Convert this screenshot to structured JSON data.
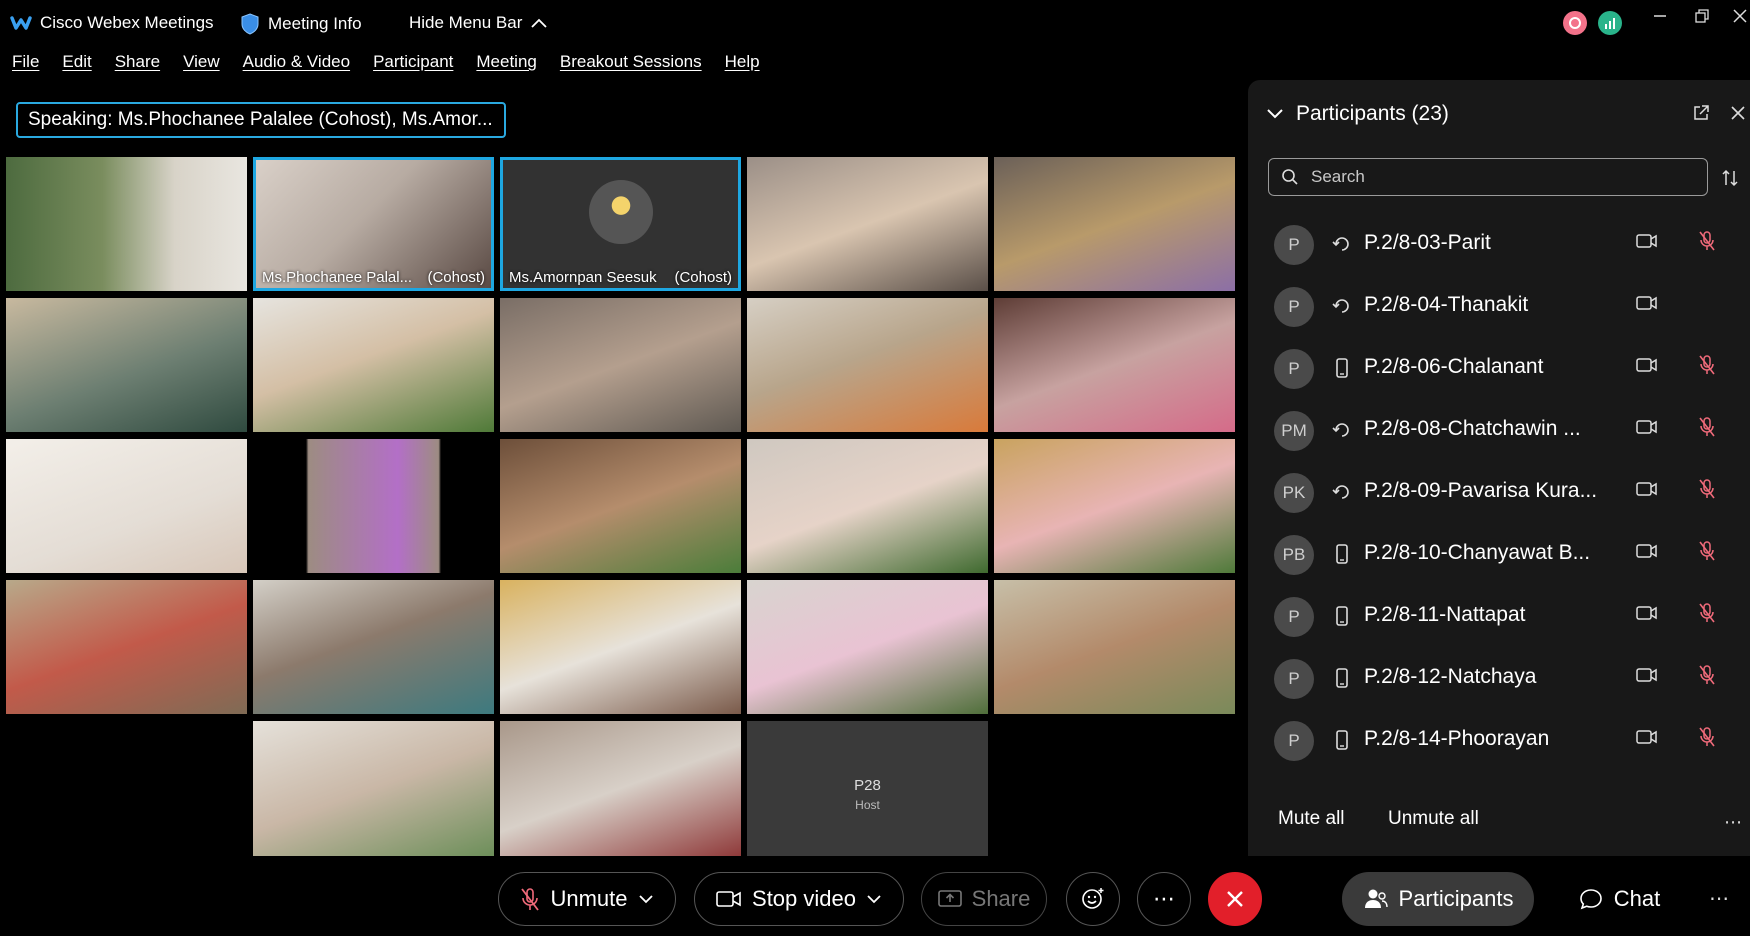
{
  "app": {
    "title": "Cisco Webex Meetings",
    "meeting_info": "Meeting Info",
    "hide_menu": "Hide Menu Bar"
  },
  "menu": [
    "File",
    "Edit",
    "Share",
    "View",
    "Audio & Video",
    "Participant",
    "Meeting",
    "Breakout Sessions",
    "Help"
  ],
  "speaking": {
    "label": "Speaking:",
    "names": "Ms.Phochanee Palalee (Cohost), Ms.Amor..."
  },
  "tiles": {
    "phochanee": {
      "name": "Ms.Phochanee Palal...",
      "role": "(Cohost)"
    },
    "amornpan": {
      "name": "Ms.Amornpan Seesuk",
      "role": "(Cohost)"
    },
    "p28": {
      "name": "P28",
      "role": "Host"
    }
  },
  "panel": {
    "title": "Participants (23)",
    "search_placeholder": "Search",
    "participants": [
      {
        "initials": "P",
        "device": "sync",
        "name": "P.2/8-03-Parit",
        "muted": true
      },
      {
        "initials": "P",
        "device": "sync",
        "name": "P.2/8-04-Thanakit",
        "muted": false
      },
      {
        "initials": "P",
        "device": "phone",
        "name": "P.2/8-06-Chalanant",
        "muted": true
      },
      {
        "initials": "PM",
        "device": "sync",
        "name": "P.2/8-08-Chatchawin ...",
        "muted": true
      },
      {
        "initials": "PK",
        "device": "sync",
        "name": "P.2/8-09-Pavarisa Kura...",
        "muted": true
      },
      {
        "initials": "PB",
        "device": "phone",
        "name": "P.2/8-10-Chanyawat B...",
        "muted": true
      },
      {
        "initials": "P",
        "device": "phone",
        "name": "P.2/8-11-Nattapat",
        "muted": true
      },
      {
        "initials": "P",
        "device": "phone",
        "name": "P.2/8-12-Natchaya",
        "muted": true
      },
      {
        "initials": "P",
        "device": "phone",
        "name": "P.2/8-14-Phoorayan",
        "muted": true
      }
    ],
    "mute_all": "Mute all",
    "unmute_all": "Unmute all"
  },
  "bottom": {
    "unmute": "Unmute",
    "stop_video": "Stop video",
    "share": "Share",
    "participants": "Participants",
    "chat": "Chat"
  },
  "colors": {
    "accent": "#1ea7e1",
    "end_call": "#e21f2a",
    "muted_icon": "#f06a7a"
  }
}
